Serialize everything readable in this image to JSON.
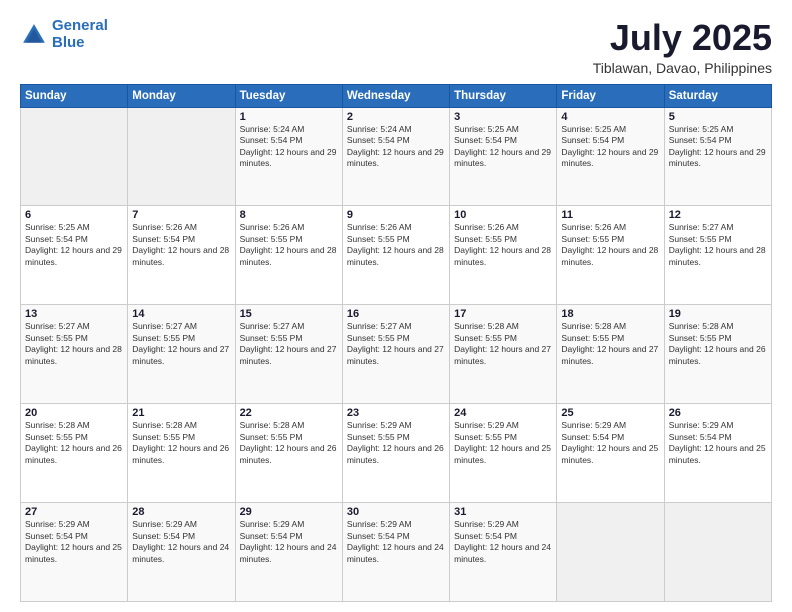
{
  "logo": {
    "line1": "General",
    "line2": "Blue"
  },
  "header": {
    "month_year": "July 2025",
    "location": "Tiblawan, Davao, Philippines"
  },
  "weekdays": [
    "Sunday",
    "Monday",
    "Tuesday",
    "Wednesday",
    "Thursday",
    "Friday",
    "Saturday"
  ],
  "weeks": [
    [
      {
        "day": "",
        "text": ""
      },
      {
        "day": "",
        "text": ""
      },
      {
        "day": "1",
        "text": "Sunrise: 5:24 AM\nSunset: 5:54 PM\nDaylight: 12 hours and 29 minutes."
      },
      {
        "day": "2",
        "text": "Sunrise: 5:24 AM\nSunset: 5:54 PM\nDaylight: 12 hours and 29 minutes."
      },
      {
        "day": "3",
        "text": "Sunrise: 5:25 AM\nSunset: 5:54 PM\nDaylight: 12 hours and 29 minutes."
      },
      {
        "day": "4",
        "text": "Sunrise: 5:25 AM\nSunset: 5:54 PM\nDaylight: 12 hours and 29 minutes."
      },
      {
        "day": "5",
        "text": "Sunrise: 5:25 AM\nSunset: 5:54 PM\nDaylight: 12 hours and 29 minutes."
      }
    ],
    [
      {
        "day": "6",
        "text": "Sunrise: 5:25 AM\nSunset: 5:54 PM\nDaylight: 12 hours and 29 minutes."
      },
      {
        "day": "7",
        "text": "Sunrise: 5:26 AM\nSunset: 5:54 PM\nDaylight: 12 hours and 28 minutes."
      },
      {
        "day": "8",
        "text": "Sunrise: 5:26 AM\nSunset: 5:55 PM\nDaylight: 12 hours and 28 minutes."
      },
      {
        "day": "9",
        "text": "Sunrise: 5:26 AM\nSunset: 5:55 PM\nDaylight: 12 hours and 28 minutes."
      },
      {
        "day": "10",
        "text": "Sunrise: 5:26 AM\nSunset: 5:55 PM\nDaylight: 12 hours and 28 minutes."
      },
      {
        "day": "11",
        "text": "Sunrise: 5:26 AM\nSunset: 5:55 PM\nDaylight: 12 hours and 28 minutes."
      },
      {
        "day": "12",
        "text": "Sunrise: 5:27 AM\nSunset: 5:55 PM\nDaylight: 12 hours and 28 minutes."
      }
    ],
    [
      {
        "day": "13",
        "text": "Sunrise: 5:27 AM\nSunset: 5:55 PM\nDaylight: 12 hours and 28 minutes."
      },
      {
        "day": "14",
        "text": "Sunrise: 5:27 AM\nSunset: 5:55 PM\nDaylight: 12 hours and 27 minutes."
      },
      {
        "day": "15",
        "text": "Sunrise: 5:27 AM\nSunset: 5:55 PM\nDaylight: 12 hours and 27 minutes."
      },
      {
        "day": "16",
        "text": "Sunrise: 5:27 AM\nSunset: 5:55 PM\nDaylight: 12 hours and 27 minutes."
      },
      {
        "day": "17",
        "text": "Sunrise: 5:28 AM\nSunset: 5:55 PM\nDaylight: 12 hours and 27 minutes."
      },
      {
        "day": "18",
        "text": "Sunrise: 5:28 AM\nSunset: 5:55 PM\nDaylight: 12 hours and 27 minutes."
      },
      {
        "day": "19",
        "text": "Sunrise: 5:28 AM\nSunset: 5:55 PM\nDaylight: 12 hours and 26 minutes."
      }
    ],
    [
      {
        "day": "20",
        "text": "Sunrise: 5:28 AM\nSunset: 5:55 PM\nDaylight: 12 hours and 26 minutes."
      },
      {
        "day": "21",
        "text": "Sunrise: 5:28 AM\nSunset: 5:55 PM\nDaylight: 12 hours and 26 minutes."
      },
      {
        "day": "22",
        "text": "Sunrise: 5:28 AM\nSunset: 5:55 PM\nDaylight: 12 hours and 26 minutes."
      },
      {
        "day": "23",
        "text": "Sunrise: 5:29 AM\nSunset: 5:55 PM\nDaylight: 12 hours and 26 minutes."
      },
      {
        "day": "24",
        "text": "Sunrise: 5:29 AM\nSunset: 5:55 PM\nDaylight: 12 hours and 25 minutes."
      },
      {
        "day": "25",
        "text": "Sunrise: 5:29 AM\nSunset: 5:54 PM\nDaylight: 12 hours and 25 minutes."
      },
      {
        "day": "26",
        "text": "Sunrise: 5:29 AM\nSunset: 5:54 PM\nDaylight: 12 hours and 25 minutes."
      }
    ],
    [
      {
        "day": "27",
        "text": "Sunrise: 5:29 AM\nSunset: 5:54 PM\nDaylight: 12 hours and 25 minutes."
      },
      {
        "day": "28",
        "text": "Sunrise: 5:29 AM\nSunset: 5:54 PM\nDaylight: 12 hours and 24 minutes."
      },
      {
        "day": "29",
        "text": "Sunrise: 5:29 AM\nSunset: 5:54 PM\nDaylight: 12 hours and 24 minutes."
      },
      {
        "day": "30",
        "text": "Sunrise: 5:29 AM\nSunset: 5:54 PM\nDaylight: 12 hours and 24 minutes."
      },
      {
        "day": "31",
        "text": "Sunrise: 5:29 AM\nSunset: 5:54 PM\nDaylight: 12 hours and 24 minutes."
      },
      {
        "day": "",
        "text": ""
      },
      {
        "day": "",
        "text": ""
      }
    ]
  ]
}
